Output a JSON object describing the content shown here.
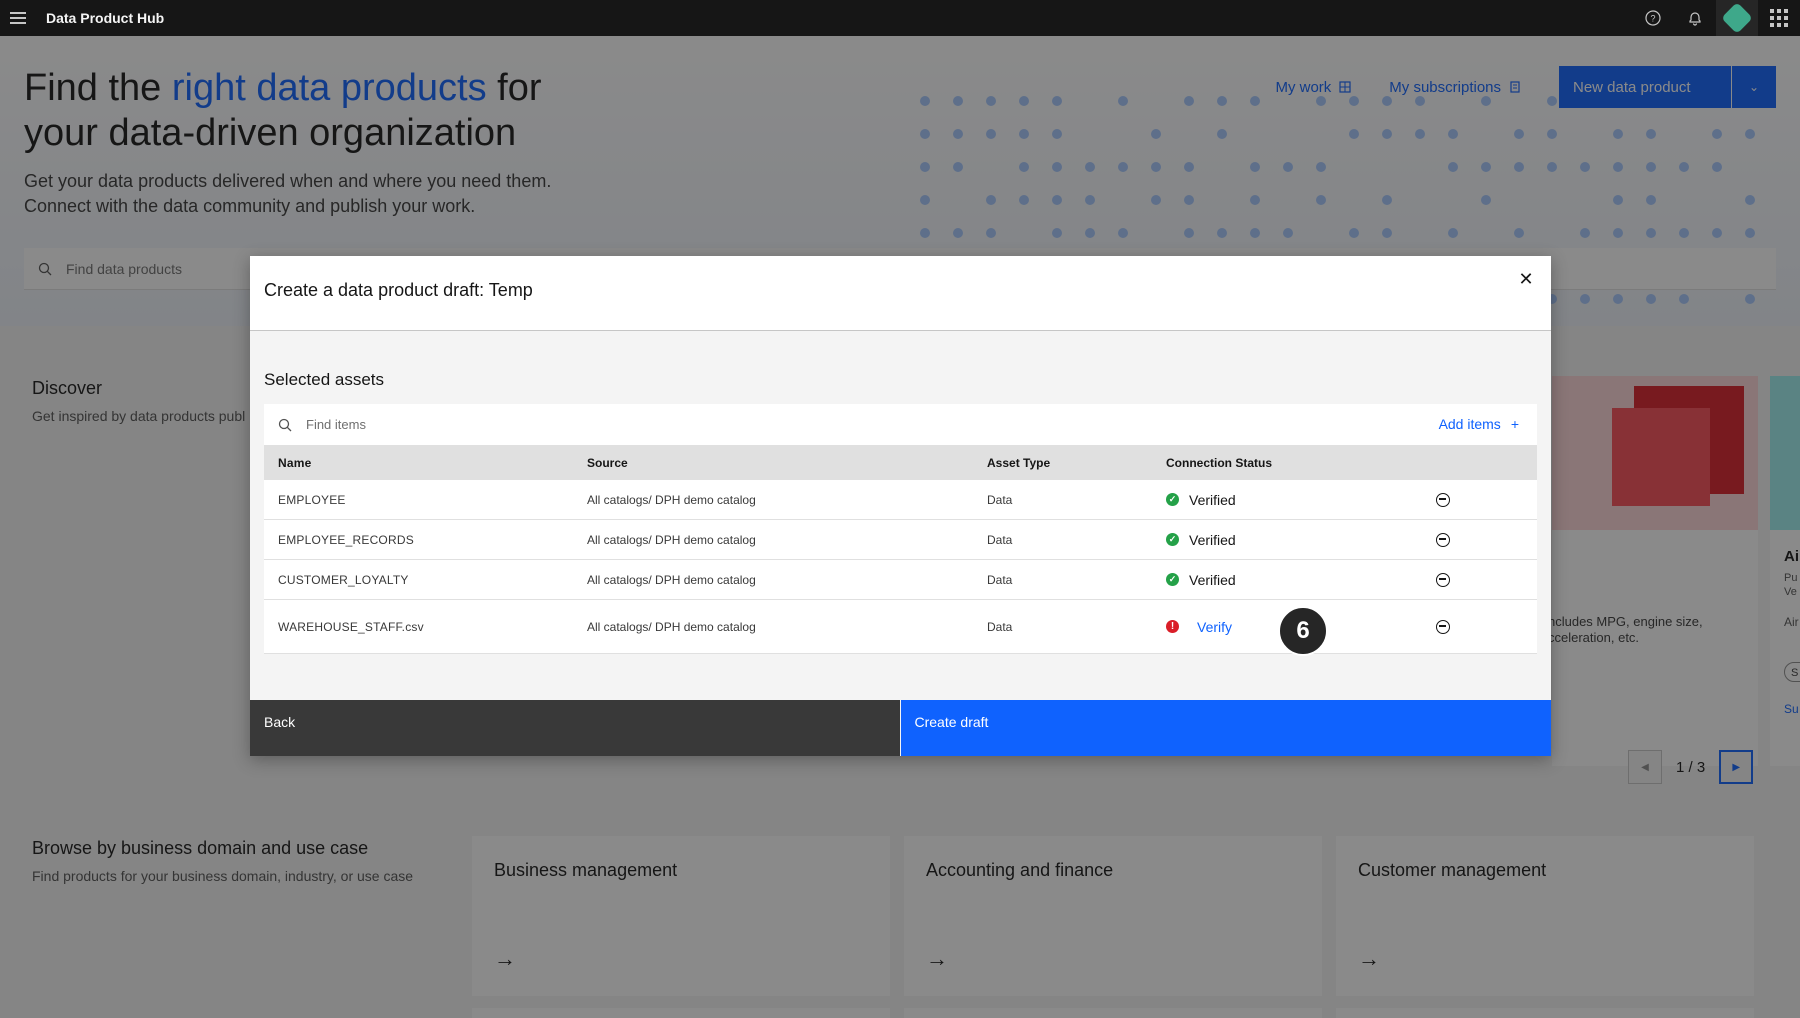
{
  "topbar": {
    "app_title": "Data Product Hub"
  },
  "hero": {
    "title_pre": "Find the ",
    "title_accent": "right data products",
    "title_post": " for your data-driven organization",
    "subtitle": "Get your data products delivered when and where you need them. Connect with the data community and publish your work.",
    "my_work": "My work",
    "my_subscriptions": "My subscriptions",
    "new_product": "New data product",
    "search_placeholder": "Find data products"
  },
  "discover": {
    "title": "Discover",
    "subtitle": "Get inspired by data products publ",
    "card_text": "ncludes MPG, engine size, cceleration, etc.",
    "edge_title": "Ai",
    "edge_sub1": "Pu",
    "edge_sub2": "Ve",
    "edge_sub3": "Air",
    "edge_pill": "S",
    "edge_link": "Su"
  },
  "pager": {
    "text": "1 / 3"
  },
  "browse": {
    "title": "Browse by business domain and use case",
    "subtitle": "Find products for your business domain, industry, or use case",
    "cards": [
      "Business management",
      "Accounting and finance",
      "Customer management"
    ]
  },
  "modal": {
    "title": "Create a data product draft: Temp",
    "section_title": "Selected assets",
    "search_placeholder": "Find items",
    "add_items": "Add items",
    "columns": {
      "name": "Name",
      "source": "Source",
      "type": "Asset Type",
      "status": "Connection Status"
    },
    "rows": [
      {
        "name": "EMPLOYEE",
        "source": "All catalogs/ DPH demo catalog",
        "type": "Data",
        "status": "Verified"
      },
      {
        "name": "EMPLOYEE_RECORDS",
        "source": "All catalogs/ DPH demo catalog",
        "type": "Data",
        "status": "Verified"
      },
      {
        "name": "CUSTOMER_LOYALTY",
        "source": "All catalogs/ DPH demo catalog",
        "type": "Data",
        "status": "Verified"
      },
      {
        "name": "WAREHOUSE_STAFF.csv",
        "source": "All catalogs/ DPH demo catalog",
        "type": "Data",
        "status": "Verify"
      }
    ],
    "back": "Back",
    "create": "Create draft",
    "step_badge": "6"
  },
  "colors": {
    "accent": "#0f62fe",
    "success": "#24a148",
    "error": "#da1e28"
  }
}
